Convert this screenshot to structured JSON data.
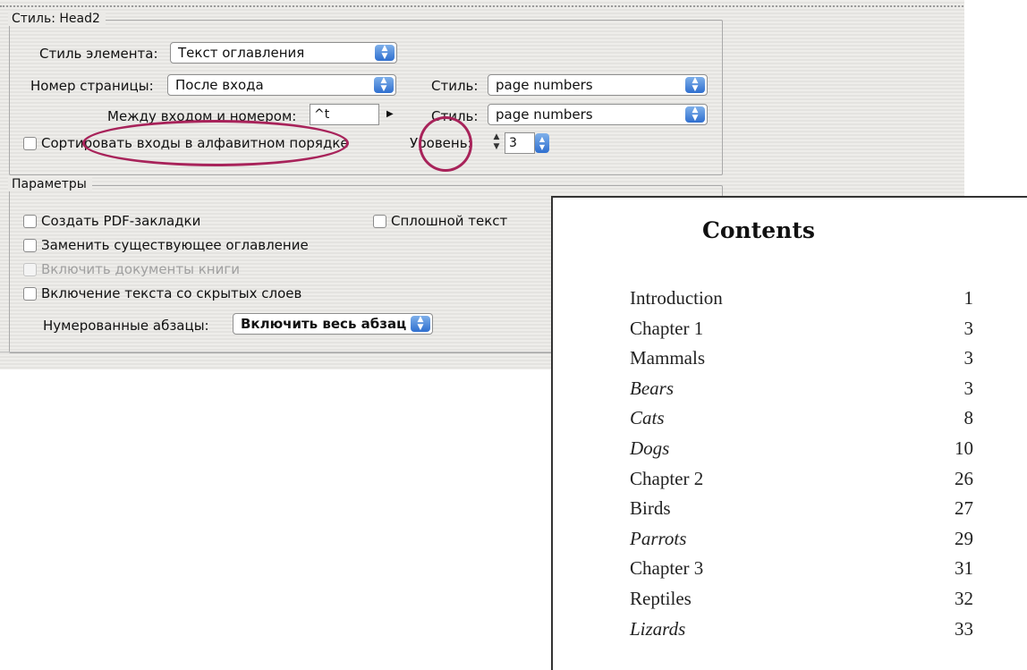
{
  "dialog": {
    "style_group": {
      "legend": "Стиль: Head2",
      "entry_style": {
        "label": "Стиль элемента:",
        "value": "Текст оглавления"
      },
      "page_number": {
        "label": "Номер страницы:",
        "value": "После входа"
      },
      "between": {
        "label": "Между входом и номером:",
        "value": "^t"
      },
      "style1": {
        "label": "Стиль:",
        "value": "page numbers"
      },
      "style2": {
        "label": "Стиль:",
        "value": "page numbers"
      },
      "sort_checkbox": {
        "label": "Сортировать входы в алфавитном порядке",
        "checked": false
      },
      "level": {
        "label": "Уровень:",
        "value": "3"
      }
    },
    "options_group": {
      "legend": "Параметры",
      "create_pdf": {
        "label": "Создать PDF-закладки",
        "checked": false
      },
      "run_in": {
        "label": "Сплошной текст",
        "checked": false
      },
      "replace_toc": {
        "label": "Заменить существующее оглавление",
        "checked": false
      },
      "include_book": {
        "label": "Включить документы книги",
        "checked": false,
        "disabled": true
      },
      "hidden_layers": {
        "label": "Включение текста со скрытых слоев",
        "checked": false
      },
      "numbered_paragraphs": {
        "label": "Нумерованные абзацы:",
        "value": "Включить весь абзац"
      }
    }
  },
  "contents": {
    "title": "Contents",
    "entries": [
      {
        "text": "Introduction",
        "page": "1",
        "italic": false
      },
      {
        "text": "Chapter 1",
        "page": "3",
        "italic": false
      },
      {
        "text": "Mammals",
        "page": "3",
        "italic": false
      },
      {
        "text": "Bears",
        "page": "3",
        "italic": true
      },
      {
        "text": "Cats",
        "page": "8",
        "italic": true
      },
      {
        "text": "Dogs",
        "page": "10",
        "italic": true
      },
      {
        "text": "Chapter 2",
        "page": "26",
        "italic": false
      },
      {
        "text": "Birds",
        "page": "27",
        "italic": false
      },
      {
        "text": "Parrots",
        "page": "29",
        "italic": true
      },
      {
        "text": "Chapter 3",
        "page": "31",
        "italic": false
      },
      {
        "text": "Reptiles",
        "page": "32",
        "italic": false
      },
      {
        "text": "Lizards",
        "page": "33",
        "italic": true
      }
    ]
  },
  "colors": {
    "highlight": "#a8235a",
    "popup_arrow": "#2f6fcf"
  }
}
